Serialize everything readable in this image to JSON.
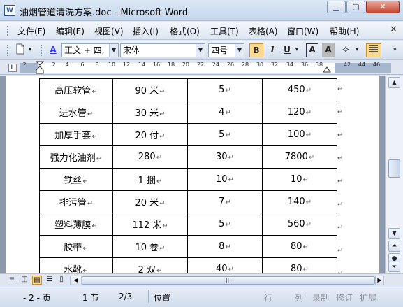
{
  "window": {
    "title": "油烟管道清洗方案.doc - Microsoft Word",
    "app_icon": "W",
    "min_label": "▁",
    "max_label": "▢",
    "close_label": "✕"
  },
  "menu": {
    "items": [
      "文件(F)",
      "编辑(E)",
      "视图(V)",
      "插入(I)",
      "格式(O)",
      "工具(T)",
      "表格(A)",
      "窗口(W)",
      "帮助(H)"
    ],
    "close_doc": "✕"
  },
  "toolbar": {
    "style_value": "正文 + 四,",
    "font_value": "宋体",
    "size_value": "四号",
    "bold_label": "B",
    "italic_label": "I",
    "underline_label": "U",
    "char_border_label": "A",
    "char_shading_label": "A"
  },
  "ruler": {
    "corner": "L",
    "ticks": [
      "2",
      "2",
      "4",
      "6",
      "8",
      "10",
      "12",
      "14",
      "16",
      "18",
      "20",
      "22",
      "24",
      "26",
      "28",
      "30",
      "32",
      "34",
      "36",
      "38",
      "42",
      "44",
      "46"
    ]
  },
  "table": {
    "mark": "↵",
    "rows": [
      [
        "高压软管",
        "90 米",
        "5",
        "450"
      ],
      [
        "进水管",
        "30 米",
        "4",
        "120"
      ],
      [
        "加厚手套",
        "20 付",
        "5",
        "100"
      ],
      [
        "强力化油剂",
        "280",
        "30",
        "7800"
      ],
      [
        "铁丝",
        "1 捆",
        "10",
        "10"
      ],
      [
        "排污管",
        "20 米",
        "7",
        "140"
      ],
      [
        "塑料薄膜",
        "112 米",
        "5",
        "560"
      ],
      [
        "胶带",
        "10 卷",
        "8",
        "80"
      ],
      [
        "水靴",
        "2 双",
        "40",
        "80"
      ]
    ]
  },
  "statusbar": {
    "page": "- 2 - 页",
    "section": "1 节",
    "page_count": "2/3",
    "position": "位置",
    "line": "行",
    "column": "列",
    "record": "录制",
    "revision": "修订",
    "extend": "扩展"
  }
}
